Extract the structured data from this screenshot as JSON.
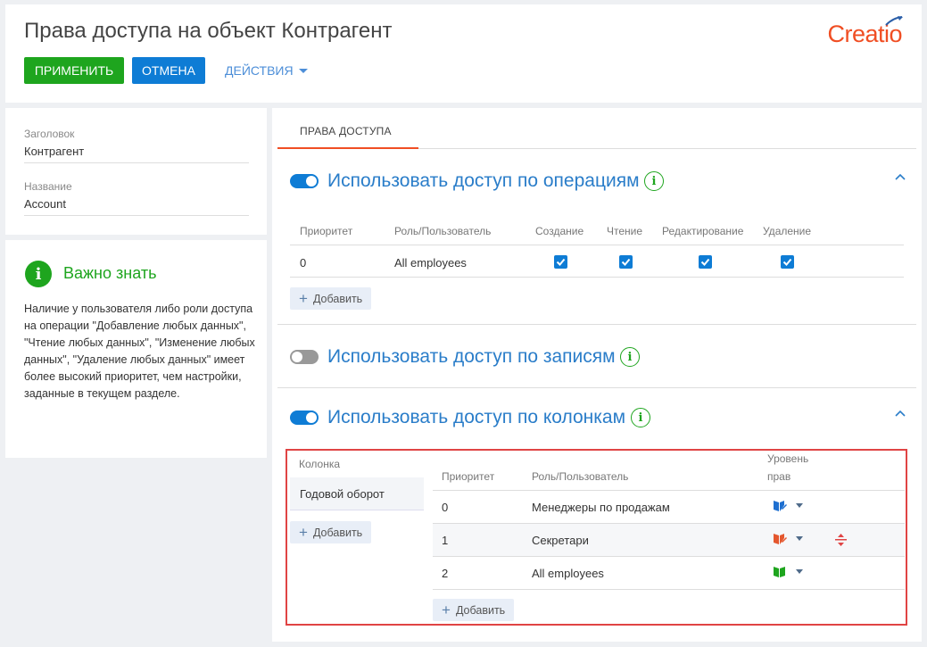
{
  "header": {
    "title": "Права доступа на объект Контрагент",
    "logo": "Creatio",
    "apply_label": "ПРИМЕНИТЬ",
    "cancel_label": "ОТМЕНА",
    "actions_label": "ДЕЙСТВИЯ"
  },
  "fields": {
    "caption_label": "Заголовок",
    "caption_value": "Контрагент",
    "name_label": "Название",
    "name_value": "Account"
  },
  "info": {
    "title": "Важно знать",
    "text": "Наличие у пользователя либо роли доступа на операции \"Добавление любых данных\", \"Чтение любых данных\", \"Изменение любых данных\", \"Удаление любых данных\" имеет более высокий приоритет, чем настройки, заданные в текущем разделе."
  },
  "tab": {
    "label": "ПРАВА ДОСТУПА"
  },
  "operations": {
    "title": "Использовать доступ по операциям",
    "enabled": true,
    "headers": [
      "Приоритет",
      "Роль/Пользователь",
      "Создание",
      "Чтение",
      "Редактирование",
      "Удаление"
    ],
    "rows": [
      {
        "priority": "0",
        "role": "All employees",
        "create": true,
        "read": true,
        "edit": true,
        "delete": true
      }
    ],
    "add_label": "Добавить"
  },
  "records": {
    "title": "Использовать доступ по записям",
    "enabled": false
  },
  "columns": {
    "title": "Использовать доступ по колонкам",
    "enabled": true,
    "column_header": "Колонка",
    "column_value": "Годовой оборот",
    "add_label": "Добавить",
    "headers": [
      "Приоритет",
      "Роль/Пользователь",
      "Уровень",
      "прав"
    ],
    "rows": [
      {
        "priority": "0",
        "role": "Менеджеры по продажам",
        "level_icon": "book-edit-icon",
        "level_color": "#1e6fd0"
      },
      {
        "priority": "1",
        "role": "Секретари",
        "level_icon": "book-edit-icon",
        "level_color": "#e4572e"
      },
      {
        "priority": "2",
        "role": "All employees",
        "level_icon": "book-icon",
        "level_color": "#1ea51e"
      }
    ],
    "add_label2": "Добавить"
  },
  "colors": {
    "green": "#1ea51e",
    "blue": "#0e7cd5",
    "accent": "#f04e23",
    "link": "#2a7dc9"
  }
}
